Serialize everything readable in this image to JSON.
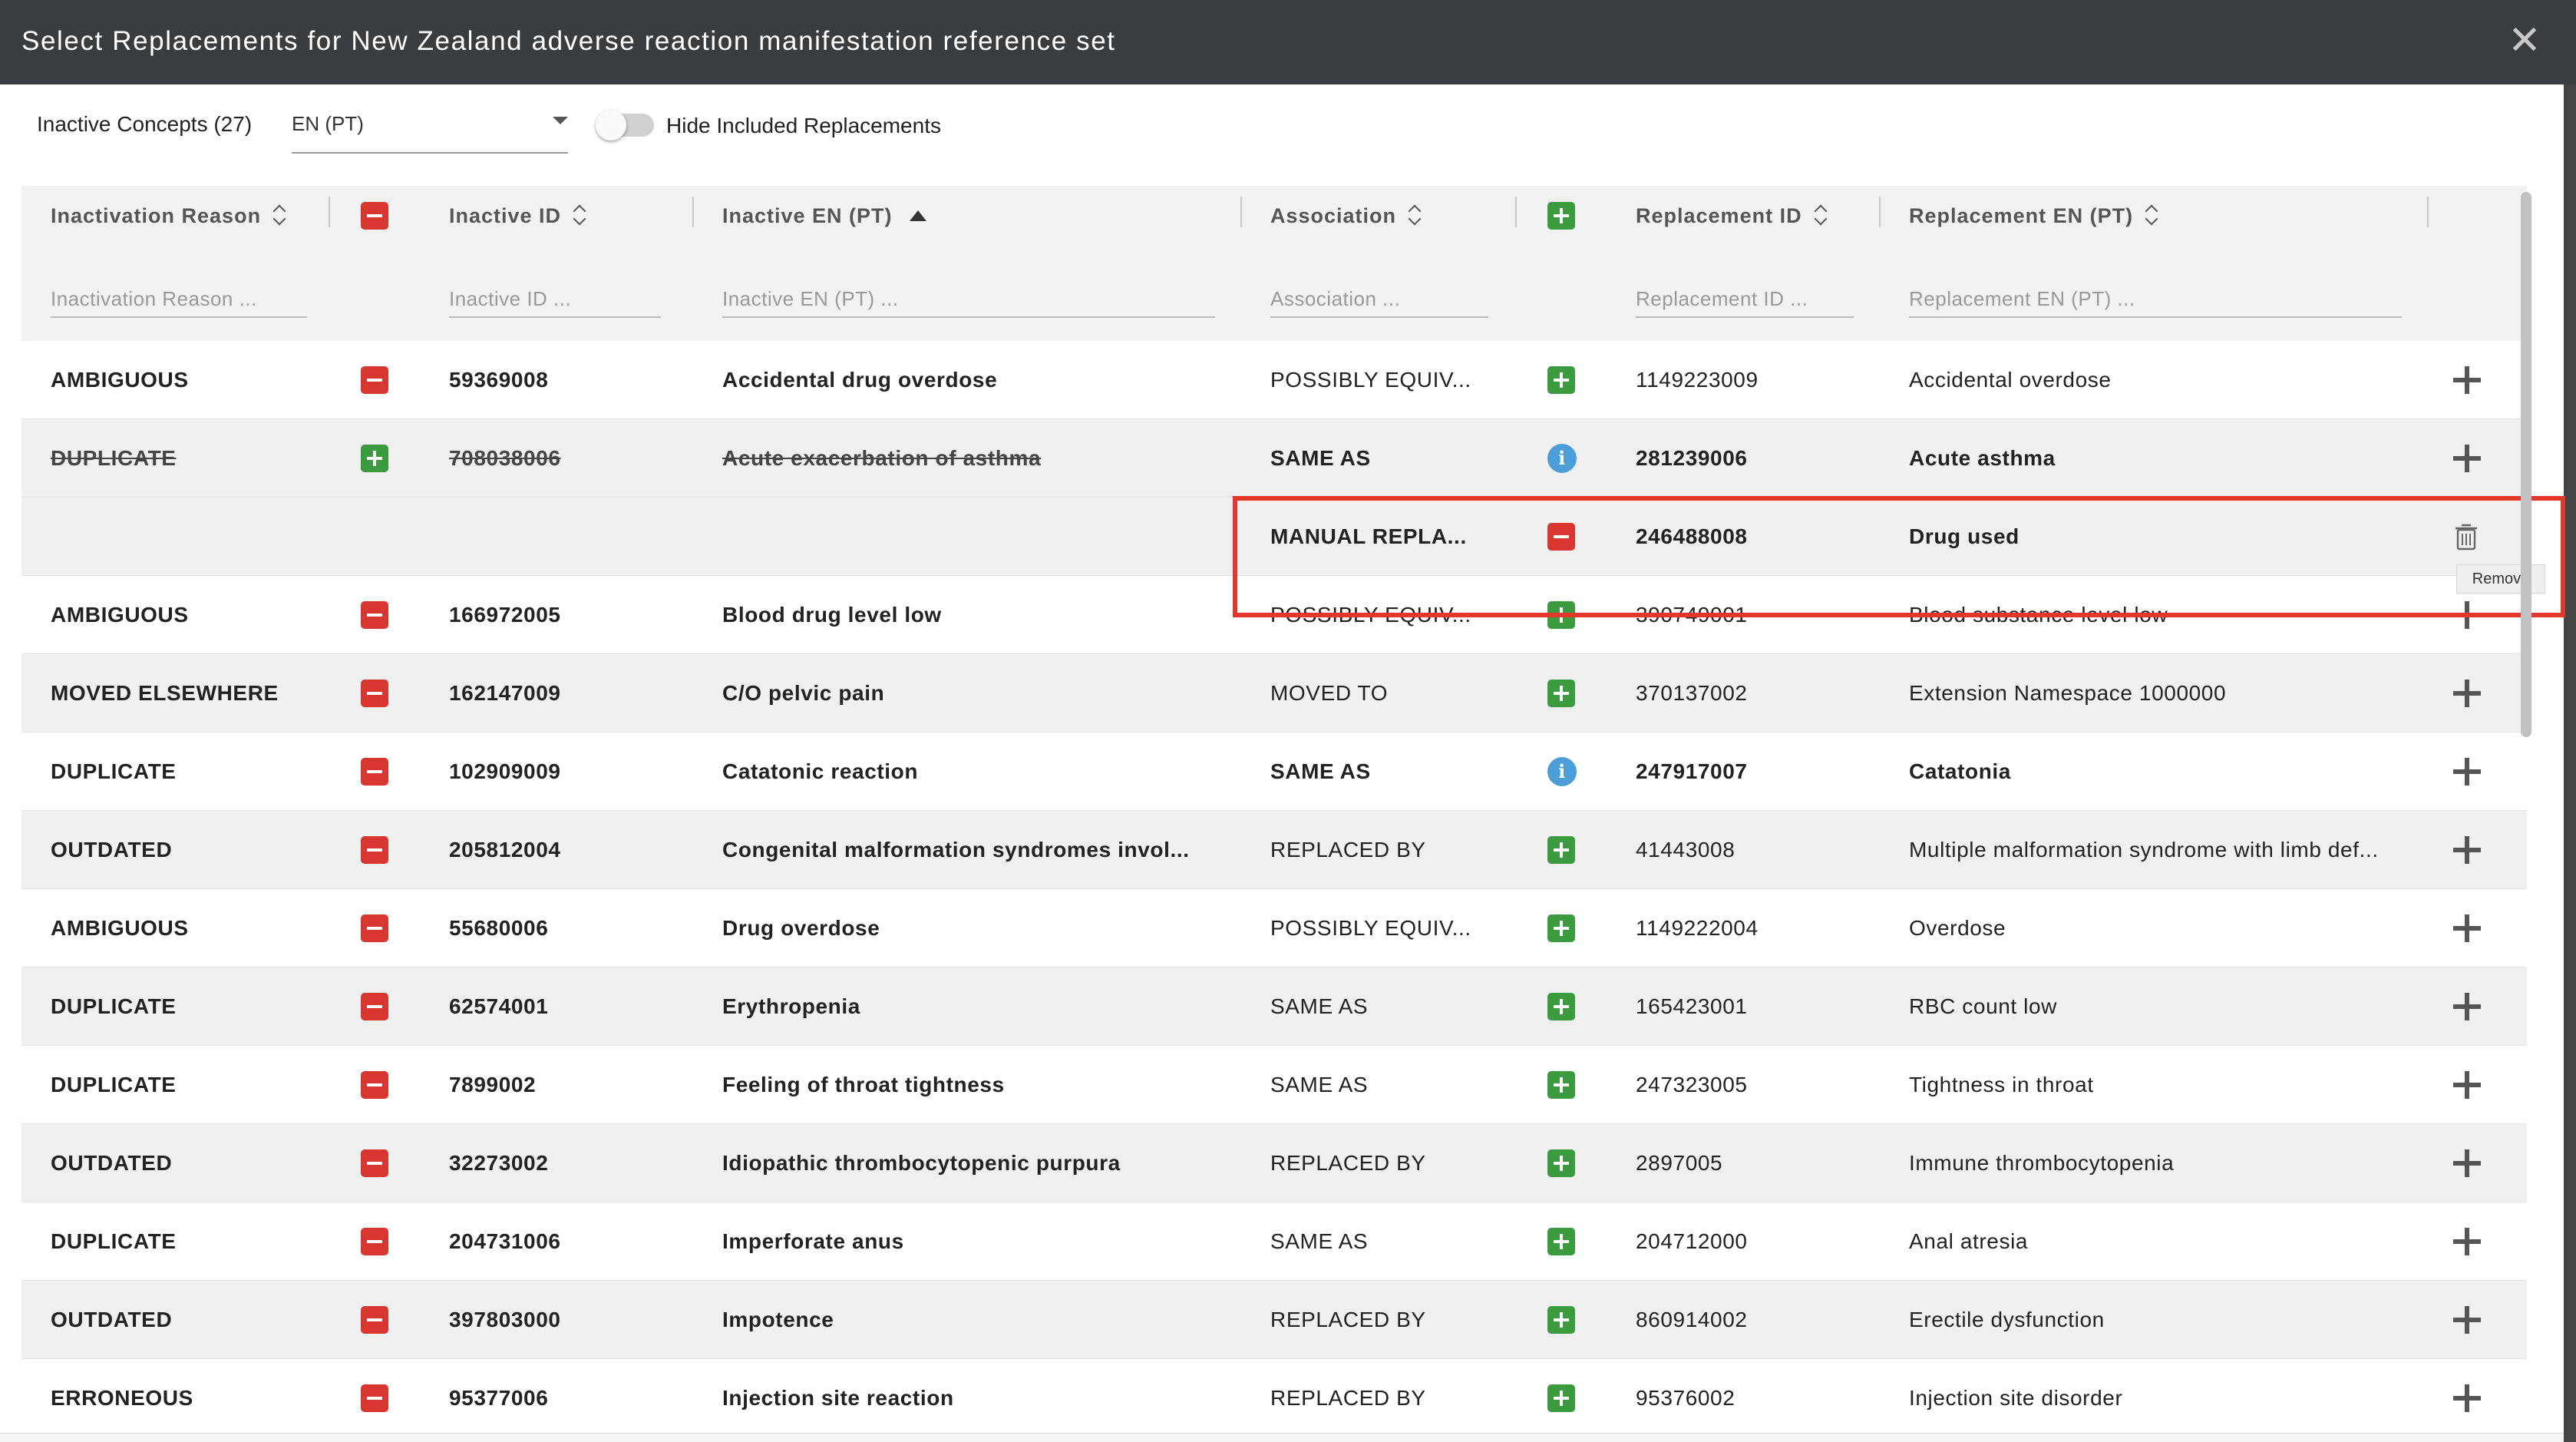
{
  "dialog": {
    "title": "Select Replacements for New Zealand adverse reaction manifestation reference set",
    "close_icon": "close-icon"
  },
  "toolbar": {
    "inactive_concepts_label": "Inactive Concepts (27)",
    "language_select_value": "EN (PT)",
    "hide_included_label": "Hide Included Replacements",
    "hide_included_on": false
  },
  "columns": {
    "inactivation_reason": "Inactivation Reason",
    "inactive_id": "Inactive ID",
    "inactive_en": "Inactive EN (PT)",
    "association": "Association",
    "replacement_id": "Replacement ID",
    "replacement_en": "Replacement EN (PT)"
  },
  "filters": {
    "inactivation_reason": "Inactivation Reason ...",
    "inactive_id": "Inactive ID ...",
    "inactive_en": "Inactive EN (PT) ...",
    "association": "Association ...",
    "replacement_id": "Replacement ID ...",
    "replacement_en": "Replacement EN (PT) ..."
  },
  "tooltip": {
    "remove": "Remove"
  },
  "rows": [
    {
      "reason": "AMBIGUOUS",
      "reason_btn": "remove",
      "inactive_id": "59369008",
      "inactive_en": "Accidental drug overdose",
      "association": "POSSIBLY EQUIV...",
      "assoc_bold": false,
      "assoc_btn": "add",
      "replacement_id": "1149223009",
      "replacement_en": "Accidental overdose",
      "repl_bold": false,
      "action": "add",
      "strike": false,
      "bg": "white"
    },
    {
      "reason": "DUPLICATE",
      "reason_btn": "add",
      "inactive_id": "708038006",
      "inactive_en": "Acute exacerbation of asthma",
      "association": "SAME AS",
      "assoc_bold": true,
      "assoc_btn": "info",
      "replacement_id": "281239006",
      "replacement_en": "Acute asthma",
      "repl_bold": true,
      "action": "add",
      "strike": true,
      "bg": "alt"
    },
    {
      "reason": "",
      "reason_btn": "",
      "inactive_id": "",
      "inactive_en": "",
      "association": "MANUAL REPLA...",
      "assoc_bold": true,
      "assoc_btn": "remove",
      "replacement_id": "246488008",
      "replacement_en": "Drug used",
      "repl_bold": true,
      "action": "delete",
      "strike": false,
      "bg": "alt"
    },
    {
      "reason": "AMBIGUOUS",
      "reason_btn": "remove",
      "inactive_id": "166972005",
      "inactive_en": "Blood drug level low",
      "association": "POSSIBLY EQUIV...",
      "assoc_bold": false,
      "assoc_btn": "add",
      "replacement_id": "390749001",
      "replacement_en": "Blood substance level low",
      "repl_bold": false,
      "action": "add",
      "strike": false,
      "bg": "white"
    },
    {
      "reason": "MOVED ELSEWHERE",
      "reason_btn": "remove",
      "inactive_id": "162147009",
      "inactive_en": "C/O pelvic pain",
      "association": "MOVED TO",
      "assoc_bold": false,
      "assoc_btn": "add",
      "replacement_id": "370137002",
      "replacement_en": "Extension Namespace 1000000",
      "repl_bold": false,
      "action": "add",
      "strike": false,
      "bg": "alt"
    },
    {
      "reason": "DUPLICATE",
      "reason_btn": "remove",
      "inactive_id": "102909009",
      "inactive_en": "Catatonic reaction",
      "association": "SAME AS",
      "assoc_bold": true,
      "assoc_btn": "info",
      "replacement_id": "247917007",
      "replacement_en": "Catatonia",
      "repl_bold": true,
      "action": "add",
      "strike": false,
      "bg": "white"
    },
    {
      "reason": "OUTDATED",
      "reason_btn": "remove",
      "inactive_id": "205812004",
      "inactive_en": "Congenital malformation syndromes invol...",
      "association": "REPLACED BY",
      "assoc_bold": false,
      "assoc_btn": "add",
      "replacement_id": "41443008",
      "replacement_en": "Multiple malformation syndrome with limb def...",
      "repl_bold": false,
      "action": "add",
      "strike": false,
      "bg": "alt"
    },
    {
      "reason": "AMBIGUOUS",
      "reason_btn": "remove",
      "inactive_id": "55680006",
      "inactive_en": "Drug overdose",
      "association": "POSSIBLY EQUIV...",
      "assoc_bold": false,
      "assoc_btn": "add",
      "replacement_id": "1149222004",
      "replacement_en": "Overdose",
      "repl_bold": false,
      "action": "add",
      "strike": false,
      "bg": "white"
    },
    {
      "reason": "DUPLICATE",
      "reason_btn": "remove",
      "inactive_id": "62574001",
      "inactive_en": "Erythropenia",
      "association": "SAME AS",
      "assoc_bold": false,
      "assoc_btn": "add",
      "replacement_id": "165423001",
      "replacement_en": "RBC count low",
      "repl_bold": false,
      "action": "add",
      "strike": false,
      "bg": "alt"
    },
    {
      "reason": "DUPLICATE",
      "reason_btn": "remove",
      "inactive_id": "7899002",
      "inactive_en": "Feeling of throat tightness",
      "association": "SAME AS",
      "assoc_bold": false,
      "assoc_btn": "add",
      "replacement_id": "247323005",
      "replacement_en": "Tightness in throat",
      "repl_bold": false,
      "action": "add",
      "strike": false,
      "bg": "white"
    },
    {
      "reason": "OUTDATED",
      "reason_btn": "remove",
      "inactive_id": "32273002",
      "inactive_en": "Idiopathic thrombocytopenic purpura",
      "association": "REPLACED BY",
      "assoc_bold": false,
      "assoc_btn": "add",
      "replacement_id": "2897005",
      "replacement_en": "Immune thrombocytopenia",
      "repl_bold": false,
      "action": "add",
      "strike": false,
      "bg": "alt"
    },
    {
      "reason": "DUPLICATE",
      "reason_btn": "remove",
      "inactive_id": "204731006",
      "inactive_en": "Imperforate anus",
      "association": "SAME AS",
      "assoc_bold": false,
      "assoc_btn": "add",
      "replacement_id": "204712000",
      "replacement_en": "Anal atresia",
      "repl_bold": false,
      "action": "add",
      "strike": false,
      "bg": "white"
    },
    {
      "reason": "OUTDATED",
      "reason_btn": "remove",
      "inactive_id": "397803000",
      "inactive_en": "Impotence",
      "association": "REPLACED BY",
      "assoc_bold": false,
      "assoc_btn": "add",
      "replacement_id": "860914002",
      "replacement_en": "Erectile dysfunction",
      "repl_bold": false,
      "action": "add",
      "strike": false,
      "bg": "alt"
    },
    {
      "reason": "ERRONEOUS",
      "reason_btn": "remove",
      "inactive_id": "95377006",
      "inactive_en": "Injection site reaction",
      "association": "REPLACED BY",
      "assoc_bold": false,
      "assoc_btn": "add",
      "replacement_id": "95376002",
      "replacement_en": "Injection site disorder",
      "repl_bold": false,
      "action": "add",
      "strike": false,
      "bg": "white"
    }
  ]
}
